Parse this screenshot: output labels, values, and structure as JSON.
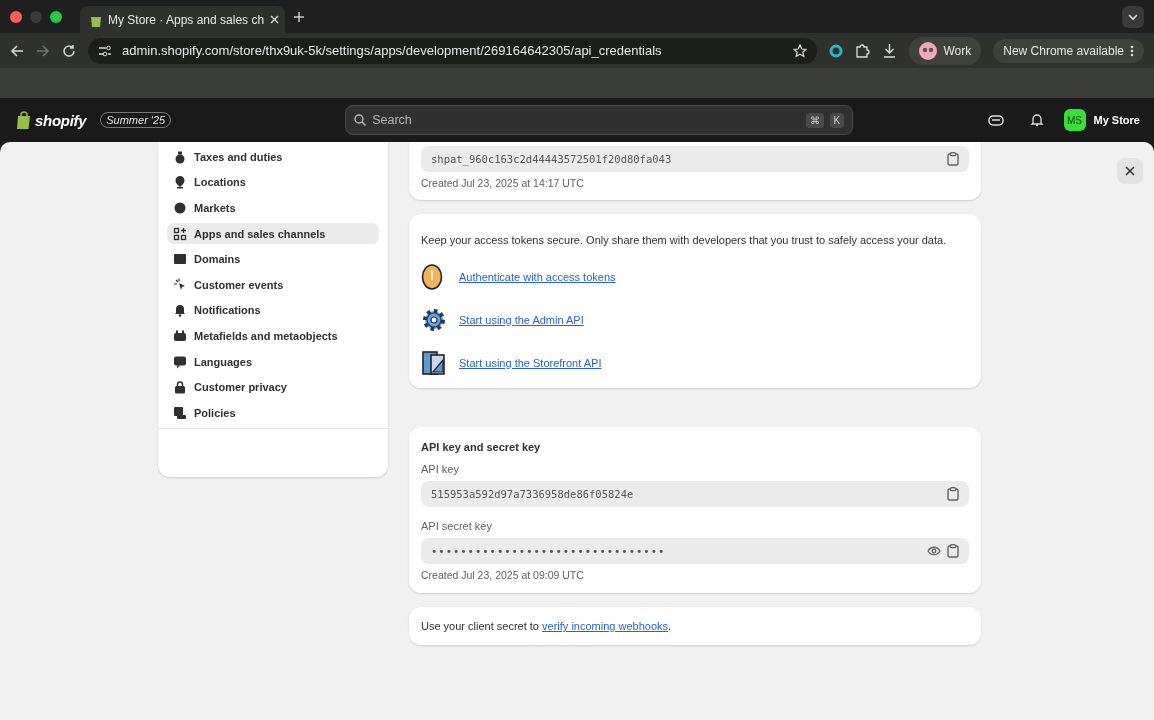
{
  "browser": {
    "tab_title": "My Store · Apps and sales ch",
    "url": "admin.shopify.com/store/thx9uk-5k/settings/apps/development/269164642305/api_credentials",
    "profile": "Work",
    "update_button": "New Chrome available"
  },
  "topbar": {
    "logo": "shopify",
    "edition_badge": "Summer '25",
    "search_placeholder": "Search",
    "shortcut_keys": [
      "⌘",
      "K"
    ],
    "avatar_initials": "MS",
    "store_name": "My Store"
  },
  "sidebar": {
    "items": [
      {
        "label": "Taxes and duties",
        "selected": false
      },
      {
        "label": "Locations",
        "selected": false
      },
      {
        "label": "Markets",
        "selected": false
      },
      {
        "label": "Apps and sales channels",
        "selected": true
      },
      {
        "label": "Domains",
        "selected": false
      },
      {
        "label": "Customer events",
        "selected": false
      },
      {
        "label": "Notifications",
        "selected": false
      },
      {
        "label": "Metafields and metaobjects",
        "selected": false
      },
      {
        "label": "Languages",
        "selected": false
      },
      {
        "label": "Customer privacy",
        "selected": false
      },
      {
        "label": "Policies",
        "selected": false
      }
    ]
  },
  "token_card": {
    "value": "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",
    "created": "Created Jul 23, 2025 at 14:17 UTC"
  },
  "info_card": {
    "text": "Keep your access tokens secure. Only share them with developers that you trust to safely access your data.",
    "links": [
      {
        "label": "Authenticate with access tokens"
      },
      {
        "label": "Start using the Admin API"
      },
      {
        "label": "Start using the Storefront API"
      }
    ]
  },
  "api_card": {
    "title": "API key and secret key",
    "fields": [
      {
        "kind": "plain",
        "label": "API key",
        "value": "515953a592d97a7336958de86f05824e"
      },
      {
        "kind": "secret",
        "label": "API secret key",
        "value": "••••••••••••••••••••••••••••••••"
      }
    ],
    "created": "Created Jul 23, 2025 at 09:09 UTC"
  },
  "webhook_note": {
    "before": "Use your client secret to",
    "link": "verify incoming webhooks",
    "after": "."
  }
}
